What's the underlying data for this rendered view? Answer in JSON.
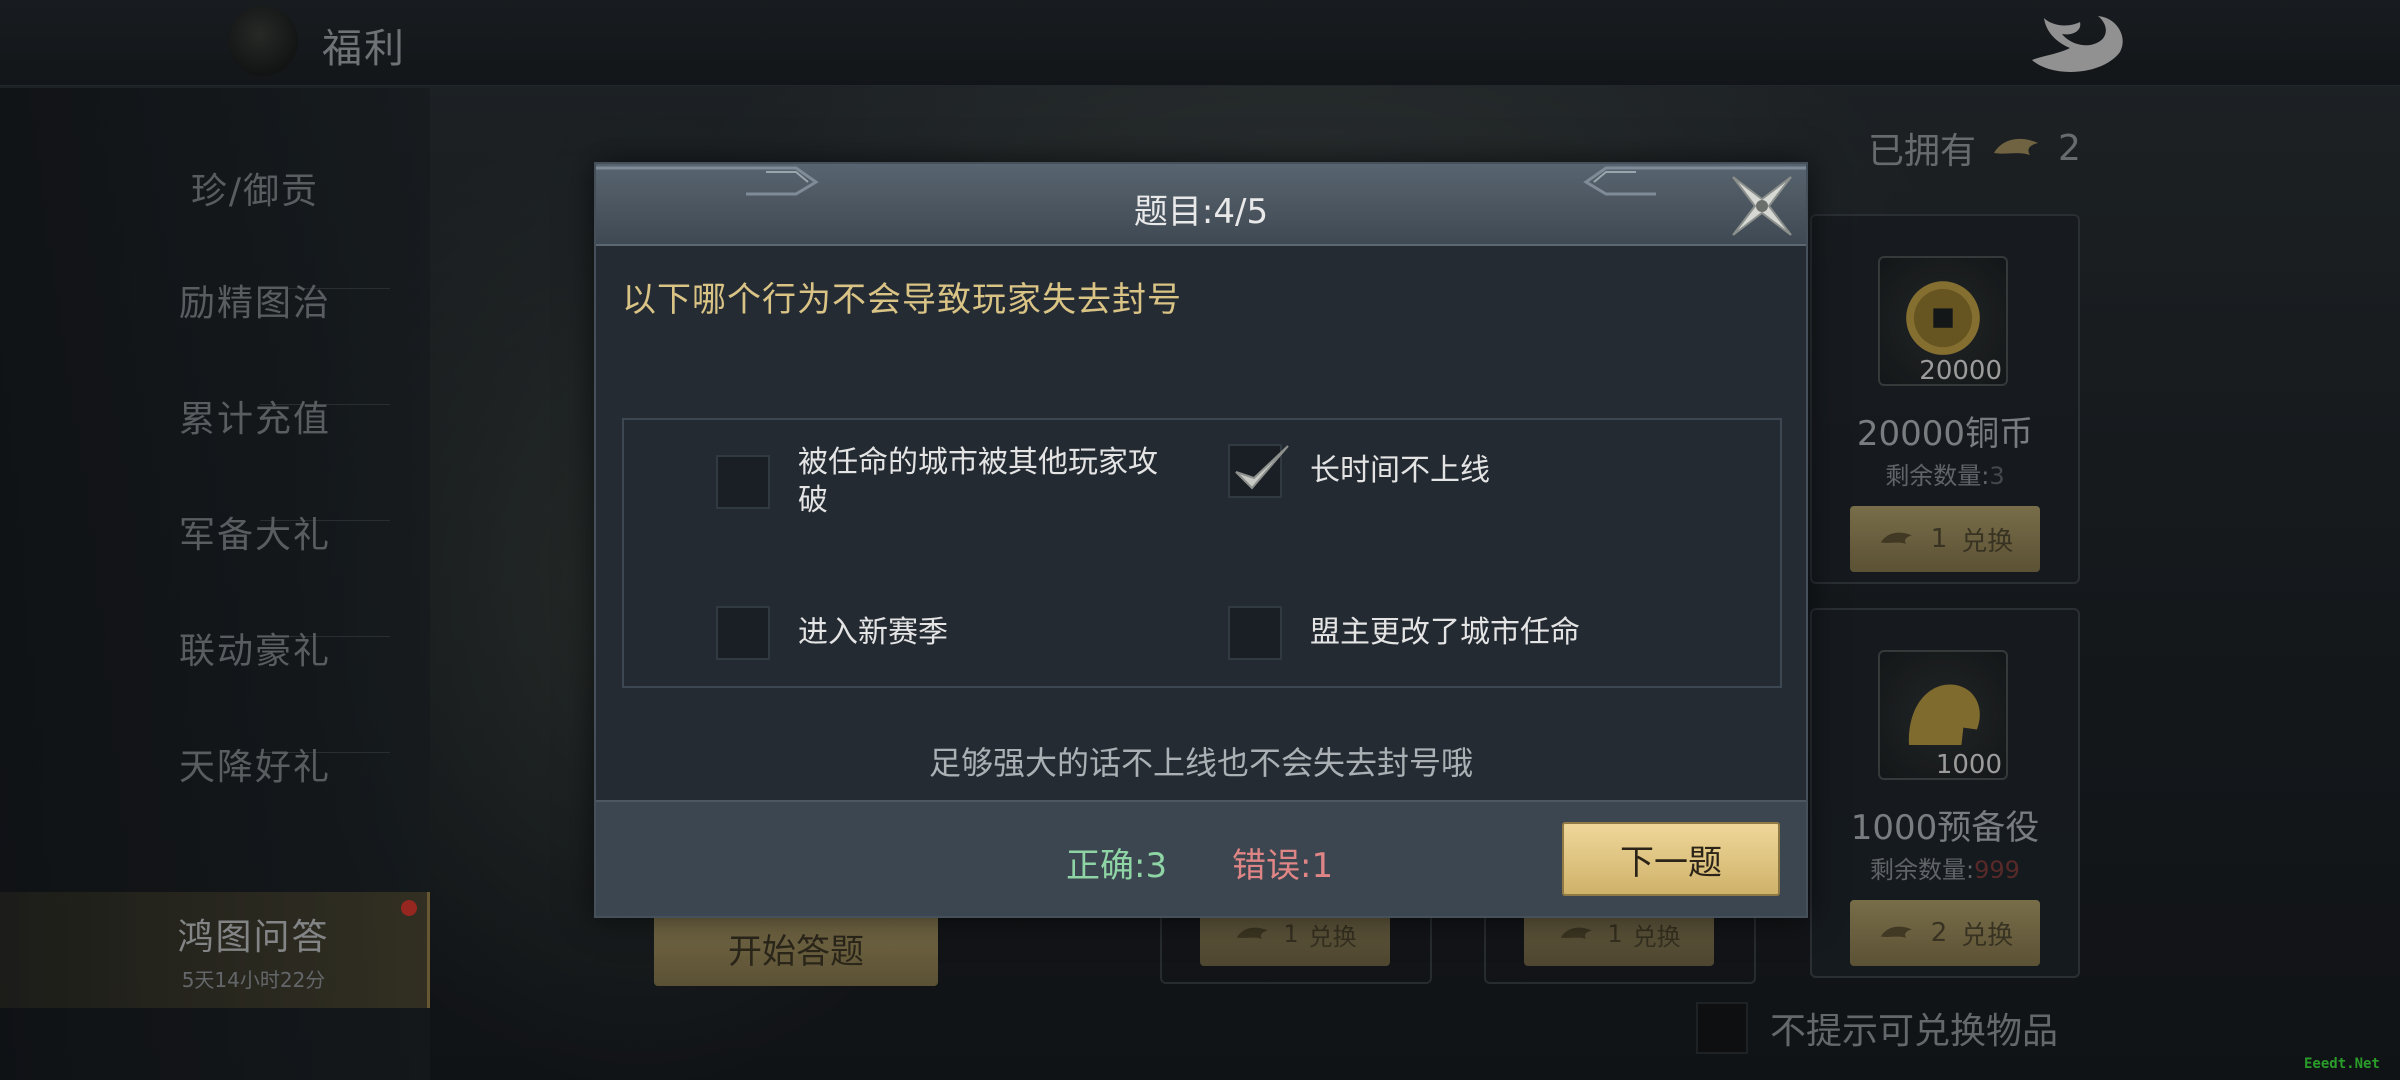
{
  "header": {
    "title": "福利"
  },
  "sidebar": {
    "items": [
      {
        "label": "珍/御贡"
      },
      {
        "label": "励精图治"
      },
      {
        "label": "累计充值"
      },
      {
        "label": "军备大礼"
      },
      {
        "label": "联动豪礼"
      },
      {
        "label": "天降好礼"
      },
      {
        "label": "鸿图问答",
        "sub": "5天14小时22分",
        "active": true
      }
    ]
  },
  "shop": {
    "owned_label": "已拥有",
    "owned_count": "2",
    "start_button": "开始答题",
    "cards": [
      {
        "qty": "20000",
        "name": "20000铜币",
        "remain_label": "剩余数量:",
        "remain_value": "3",
        "cost": "1",
        "exchange": "兑换"
      },
      {
        "qty": "1000",
        "name": "1000预备役",
        "remain_label": "剩余数量:",
        "remain_value": "999",
        "cost": "2",
        "exchange": "兑换"
      }
    ],
    "small_exchanges": [
      {
        "cost": "1",
        "exchange": "兑换"
      },
      {
        "cost": "1",
        "exchange": "兑换"
      }
    ],
    "no_prompt_label": "不提示可兑换物品"
  },
  "quiz": {
    "title": "题目:4/5",
    "question": "以下哪个行为不会导致玩家失去封号",
    "options": [
      {
        "text": "被任命的城市被其他玩家攻破",
        "checked": false
      },
      {
        "text": "长时间不上线",
        "checked": true
      },
      {
        "text": "进入新赛季",
        "checked": false
      },
      {
        "text": "盟主更改了城市任命",
        "checked": false
      }
    ],
    "hint": "足够强大的话不上线也不会失去封号哦",
    "correct": "正确:3",
    "wrong": "错误:1",
    "next_button": "下一题"
  },
  "watermark": "Eeedt.Net",
  "colors": {
    "accent_gold": "#d9c385",
    "correct_green": "#8fd4a5",
    "wrong_red": "#e08585",
    "button_gold": "#e6cb86"
  }
}
